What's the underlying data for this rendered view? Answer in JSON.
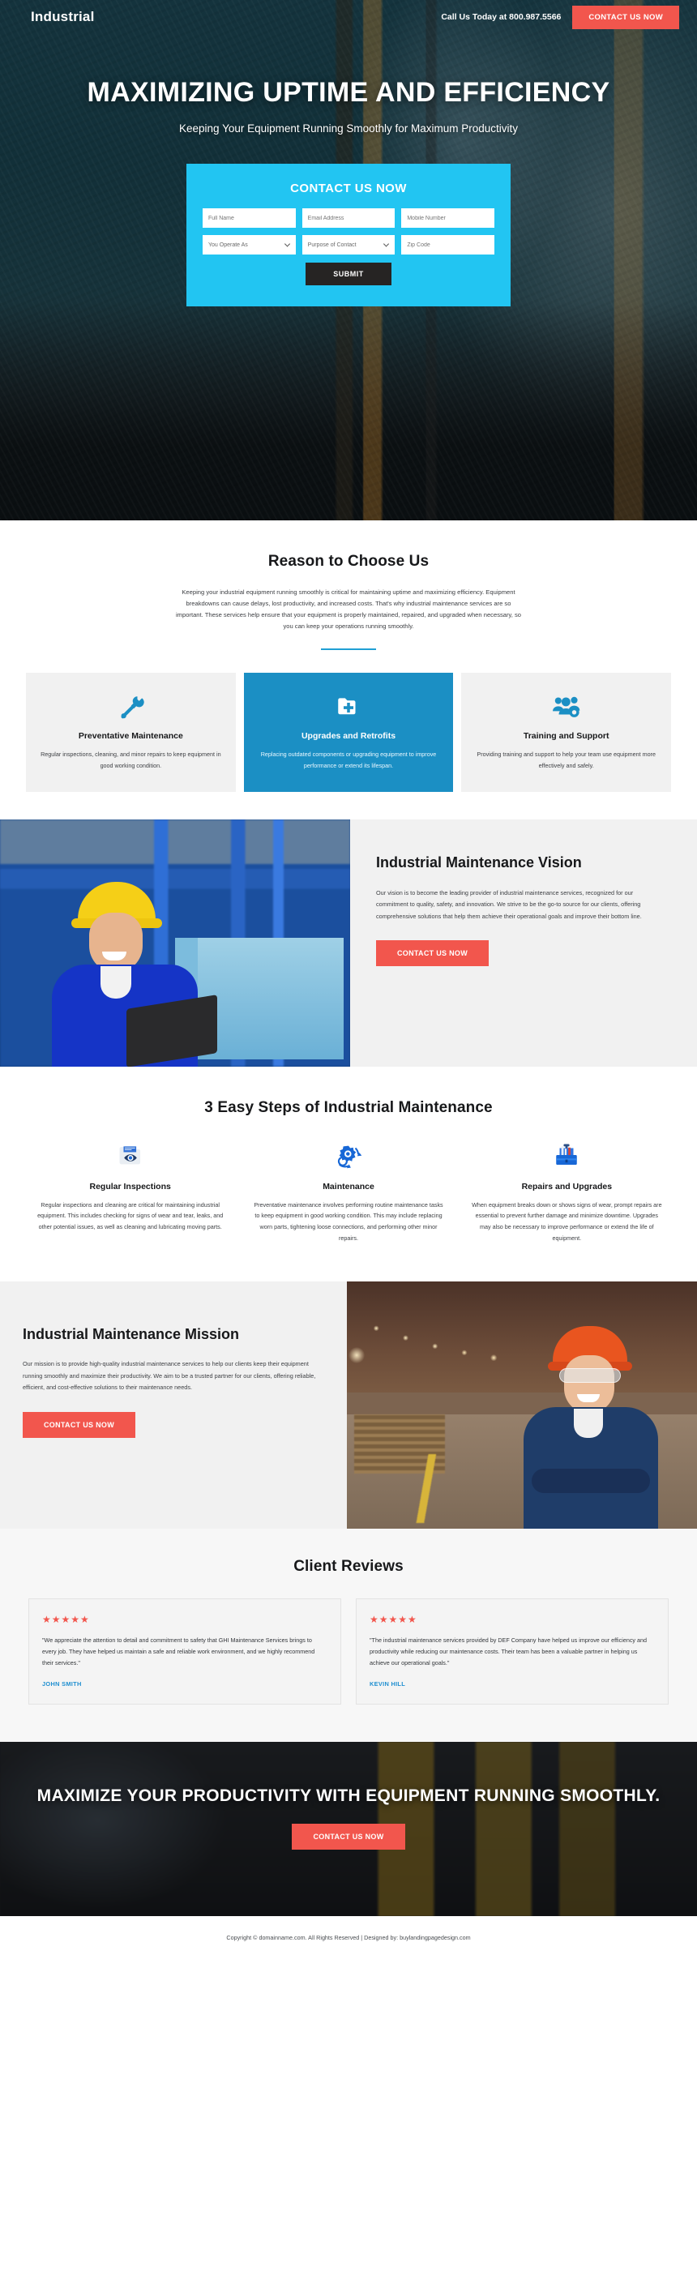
{
  "header": {
    "logo": "Industrial",
    "phone_text": "Call Us Today at 800.987.5566",
    "cta_label": "CONTACT US NOW"
  },
  "hero": {
    "headline": "MAXIMIZING UPTIME AND EFFICIENCY",
    "subheadline": "Keeping Your Equipment Running Smoothly for Maximum Productivity"
  },
  "form": {
    "title": "CONTACT US NOW",
    "full_name_placeholder": "Full Name",
    "email_placeholder": "Email Address",
    "mobile_placeholder": "Mobile Number",
    "operate_as_value": "You Operate As",
    "purpose_value": "Purpose of Contact",
    "zip_placeholder": "Zip Code",
    "submit_label": "SUBMIT"
  },
  "reason": {
    "title": "Reason to Choose Us",
    "paragraph": "Keeping your industrial equipment running smoothly is critical for maintaining uptime and maximizing efficiency. Equipment breakdowns can cause delays, lost productivity, and increased costs. That's why industrial maintenance services are so important. These services help ensure that your equipment is properly maintained, repaired, and upgraded when necessary, so you can keep your operations running smoothly.",
    "cards": [
      {
        "icon": "wrench-screwdriver-icon",
        "title": "Preventative Maintenance",
        "text": "Regular inspections, cleaning, and minor repairs to keep equipment in good working condition."
      },
      {
        "icon": "folder-plus-icon",
        "title": "Upgrades and Retrofits",
        "text": "Replacing outdated components or upgrading equipment to improve performance or extend its lifespan."
      },
      {
        "icon": "people-gear-icon",
        "title": "Training and Support",
        "text": "Providing training and support to help your team use equipment more effectively and safely."
      }
    ]
  },
  "vision": {
    "title": "Industrial Maintenance Vision",
    "paragraph": "Our vision is to become the leading provider of industrial maintenance services, recognized for our commitment to quality, safety, and innovation. We strive to be the go-to source for our clients, offering comprehensive solutions that help them achieve their operational goals and improve their bottom line.",
    "cta_label": "CONTACT US NOW"
  },
  "steps": {
    "title": "3 Easy Steps of Industrial Maintenance",
    "items": [
      {
        "icon": "folder-eye-inspection-icon",
        "title": "Regular Inspections",
        "text": "Regular inspections and cleaning are critical for maintaining industrial equipment. This includes checking for signs of wear and tear, leaks, and other potential issues, as well as cleaning and lubricating moving parts."
      },
      {
        "icon": "gear-wrench-refresh-icon",
        "title": "Maintenance",
        "text": "Preventative maintenance involves performing routine maintenance tasks to keep equipment in good working condition. This may include replacing worn parts, tightening loose connections, and performing other minor repairs."
      },
      {
        "icon": "toolbox-icon",
        "title": "Repairs and Upgrades",
        "text": "When equipment breaks down or shows signs of wear, prompt repairs are essential to prevent further damage and minimize downtime. Upgrades may also be necessary to improve performance or extend the life of equipment."
      }
    ]
  },
  "mission": {
    "title": "Industrial Maintenance Mission",
    "paragraph": "Our mission is to provide high-quality industrial maintenance services to help our clients keep their equipment running smoothly and maximize their productivity. We aim to be a trusted partner for our clients, offering reliable, efficient, and cost-effective solutions to their maintenance needs.",
    "cta_label": "CONTACT US NOW"
  },
  "reviews": {
    "title": "Client Reviews",
    "items": [
      {
        "stars": "★★★★★",
        "text": "\"We appreciate the attention to detail and commitment to safety that GHI Maintenance Services brings to every job. They have helped us maintain a safe and reliable work environment, and we highly recommend their services.\"",
        "name": "JOHN SMITH"
      },
      {
        "stars": "★★★★★",
        "text": "\"The industrial maintenance services provided by DEF Company have helped us improve our efficiency and productivity while reducing our maintenance costs. Their team has been a valuable partner in helping us achieve our operational goals.\"",
        "name": "KEVIN HILL"
      }
    ]
  },
  "bottom_cta": {
    "headline": "MAXIMIZE YOUR PRODUCTIVITY WITH EQUIPMENT RUNNING SMOOTHLY.",
    "cta_label": "CONTACT US NOW"
  },
  "footer": {
    "text": "Copyright © domainname.com. All Rights Reserved | Designed by: buylandingpagedesign.com"
  },
  "colors": {
    "accent_red": "#f2564d",
    "form_blue": "#22c5f2",
    "card_blue": "#1b8fc4",
    "dark": "#262423"
  }
}
